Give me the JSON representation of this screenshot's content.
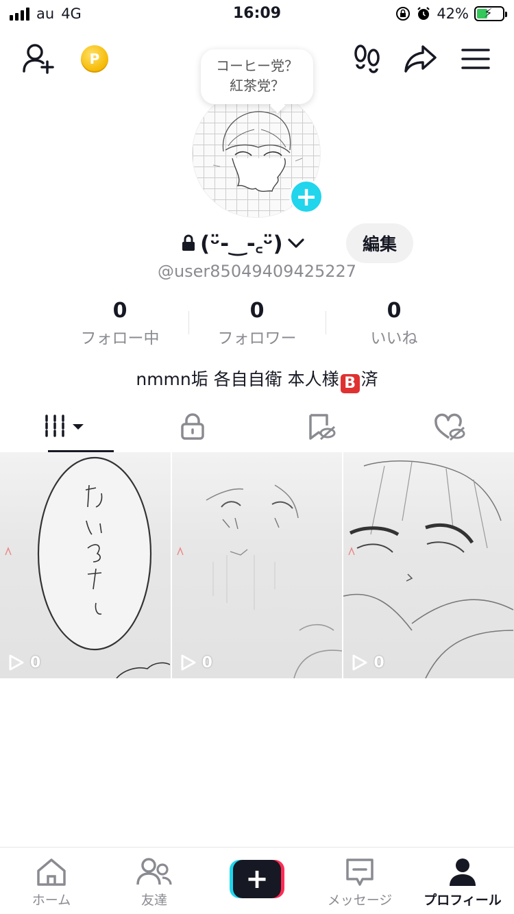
{
  "status_bar": {
    "carrier": "au",
    "network": "4G",
    "time": "16:09",
    "battery_percent": "42%",
    "battery_level": 0.42
  },
  "topbar": {
    "add_friend_icon": "person-plus-icon",
    "coin_icon": "coin-icon",
    "coin_letter": "P",
    "footprint_icon": "footprints-icon",
    "share_icon": "share-arrow-icon",
    "menu_icon": "hamburger-menu-icon"
  },
  "profile": {
    "note_line1": "コーヒー党？",
    "note_line2": "紅茶党？",
    "add_avatar_symbol": "+",
    "display_name": "(ᵕ̈-‿-꜀ᵕ̈)",
    "edit_label": "編集",
    "handle": "@user85049409425227",
    "stats": [
      {
        "value": "0",
        "label": "フォロー中"
      },
      {
        "value": "0",
        "label": "フォロワー"
      },
      {
        "value": "0",
        "label": "いいね"
      }
    ],
    "bio_prefix": "nmmn垢 各自自衛 本人様",
    "bio_emoji": "B",
    "bio_suffix": "済"
  },
  "tabs": [
    {
      "name": "videos",
      "icon": "grid-icon",
      "active": true
    },
    {
      "name": "private",
      "icon": "lock-icon",
      "active": false
    },
    {
      "name": "favorites",
      "icon": "bookmark-hidden-icon",
      "active": false
    },
    {
      "name": "liked",
      "icon": "heart-hidden-icon",
      "active": false
    }
  ],
  "videos": [
    {
      "views": "0"
    },
    {
      "views": "0"
    },
    {
      "views": "0"
    }
  ],
  "bottom_nav": {
    "home": "ホーム",
    "friends": "友達",
    "create_symbol": "+",
    "inbox": "メッセージ",
    "profile": "プロフィール"
  },
  "colors": {
    "accent_cyan": "#20d5ec",
    "accent_red": "#fe2c55",
    "text_primary": "#161823",
    "text_secondary": "#8a8b91"
  }
}
